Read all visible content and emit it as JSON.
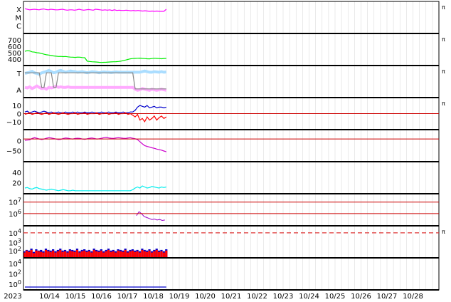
{
  "chart_data": {
    "type": "line",
    "start_label": "2023",
    "x_tick_labels": [
      "10/14",
      "10/15",
      "10/16",
      "10/17",
      "10/18",
      "10/19",
      "10/20",
      "10/21",
      "10/22",
      "10/23",
      "10/24",
      "10/25",
      "10/26",
      "10/27",
      "10/28"
    ],
    "x_range": [
      "2023-10-13",
      "2023-10-29"
    ],
    "data_end": "2023-10-18.5",
    "grid": true,
    "right_marker": "π",
    "panels": [
      {
        "id": "xray",
        "ytick_labels": [
          "X",
          "M",
          "C"
        ],
        "right_marker": true,
        "series": [
          {
            "color": "#ff00ff",
            "values": [
              0.8,
              0.78,
              0.76,
              0.77,
              0.78,
              0.77,
              0.76,
              0.78,
              0.79,
              0.77,
              0.76,
              0.78,
              0.77,
              0.76,
              0.76,
              0.77,
              0.78,
              0.76,
              0.75,
              0.76,
              0.76,
              0.75,
              0.76,
              0.78,
              0.76,
              0.75,
              0.76,
              0.77,
              0.76,
              0.75,
              0.78,
              0.77,
              0.76,
              0.75,
              0.76,
              0.75,
              0.76,
              0.74,
              0.76,
              0.74,
              0.75,
              0.74,
              0.74,
              0.75,
              0.74,
              0.73,
              0.74,
              0.73,
              0.74,
              0.73,
              0.72,
              0.73,
              0.72,
              0.71,
              0.72,
              0.71,
              0.72,
              0.71,
              0.71,
              0.71,
              0.78
            ]
          }
        ]
      },
      {
        "id": "wind_speed",
        "ytick_labels": [
          "700",
          "600",
          "500",
          "400"
        ],
        "yrange": [
          300,
          800
        ],
        "right_marker": true,
        "series": [
          {
            "color": "#00ee00",
            "values": [
              520,
              530,
              525,
              510,
              505,
              495,
              490,
              480,
              470,
              460,
              455,
              448,
              440,
              435,
              430,
              432,
              428,
              430,
              425,
              420,
              418,
              415,
              420,
              418,
              412,
              410,
              350,
              345,
              340,
              338,
              335,
              330,
              328,
              330,
              332,
              335,
              338,
              340,
              342,
              345,
              350,
              360,
              370,
              380,
              390,
              395,
              398,
              400,
              402,
              398,
              395,
              392,
              390,
              395,
              400,
              398,
              395,
              392,
              396,
              398
            ]
          }
        ]
      },
      {
        "id": "mag_sector",
        "ytick_labels": [
          "T",
          "A"
        ],
        "right_marker": true,
        "series": [
          {
            "color": "#aaddff",
            "values": [
              0.78,
              0.8,
              0.82,
              0.85,
              0.8,
              0.78,
              0.75,
              0.8,
              0.82,
              0.85,
              0.88,
              0.84,
              0.8,
              0.82,
              0.86,
              0.88,
              0.85,
              0.82,
              0.84,
              0.86,
              0.85,
              0.84,
              0.82,
              0.83,
              0.84,
              0.82,
              0.8,
              0.82,
              0.84,
              0.83,
              0.82,
              0.8,
              0.82,
              0.83,
              0.82,
              0.82,
              0.81,
              0.82,
              0.83,
              0.82,
              0.82,
              0.82,
              0.82,
              0.82,
              0.82,
              0.82,
              0.82,
              0.82,
              0.82,
              0.84,
              0.86,
              0.84,
              0.82,
              0.82,
              0.84,
              0.83,
              0.82,
              0.84,
              0.82,
              0.83
            ]
          },
          {
            "color": "#ffaaff",
            "values": [
              0.3,
              0.28,
              0.32,
              0.26,
              0.3,
              0.35,
              0.3,
              0.26,
              0.28,
              0.24,
              0.3,
              0.28,
              0.3,
              0.34,
              0.3,
              0.32,
              0.3,
              0.3,
              0.32,
              0.3,
              0.3,
              0.3,
              0.3,
              0.3,
              0.3,
              0.3,
              0.3,
              0.3,
              0.3,
              0.3,
              0.3,
              0.3,
              0.3,
              0.3,
              0.3,
              0.3,
              0.3,
              0.3,
              0.3,
              0.3,
              0.3,
              0.3,
              0.3,
              0.3,
              0.3,
              0.3,
              0.24,
              0.2,
              0.22,
              0.26,
              0.24,
              0.22,
              0.2,
              0.24,
              0.22,
              0.2,
              0.22,
              0.24,
              0.22,
              0.2
            ]
          },
          {
            "color": "#888888",
            "values": [
              0.8,
              0.8,
              0.8,
              0.8,
              0.8,
              0.8,
              0.8,
              0.3,
              0.3,
              0.8,
              0.8,
              0.8,
              0.3,
              0.3,
              0.8,
              0.8,
              0.8,
              0.8,
              0.8,
              0.8,
              0.8,
              0.8,
              0.8,
              0.8,
              0.8,
              0.8,
              0.8,
              0.8,
              0.8,
              0.8,
              0.8,
              0.8,
              0.8,
              0.8,
              0.8,
              0.8,
              0.8,
              0.8,
              0.8,
              0.8,
              0.8,
              0.8,
              0.8,
              0.8,
              0.8,
              0.8,
              0.25,
              0.25,
              0.25,
              0.25,
              0.25,
              0.25,
              0.25,
              0.25,
              0.25,
              0.25,
              0.25,
              0.25,
              0.25,
              0.25
            ]
          }
        ]
      },
      {
        "id": "imf_bz",
        "ytick_labels": [
          "10",
          "0",
          "−10"
        ],
        "yrange": [
          -18,
          18
        ],
        "zero_line": true,
        "right_marker": true,
        "series": [
          {
            "color": "#0000cc",
            "values": [
              2,
              3,
              1,
              2,
              3,
              2,
              1,
              2,
              3,
              2,
              1,
              2,
              1,
              1,
              2,
              1,
              1,
              2,
              1,
              1,
              2,
              1,
              2,
              1,
              1,
              2,
              1,
              1,
              2,
              1,
              1,
              1,
              2,
              1,
              1,
              2,
              1,
              1,
              2,
              1,
              1,
              2,
              1,
              1,
              2,
              2,
              4,
              8,
              10,
              9,
              8,
              10,
              7,
              8,
              9,
              7,
              8,
              8,
              7,
              8
            ]
          },
          {
            "color": "#ff0000",
            "values": [
              -1,
              0,
              1,
              -1,
              0,
              1,
              0,
              -1,
              0,
              1,
              -1,
              0,
              1,
              0,
              -1,
              0,
              1,
              0,
              -1,
              0,
              0,
              1,
              -1,
              0,
              0,
              1,
              -1,
              0,
              0,
              0,
              1,
              -1,
              0,
              0,
              1,
              -1,
              0,
              0,
              1,
              -1,
              0,
              0,
              1,
              -1,
              0,
              -2,
              -4,
              -1,
              -8,
              -6,
              -10,
              -4,
              -8,
              -6,
              -3,
              -8,
              -5,
              -3,
              -6,
              -4
            ]
          }
        ]
      },
      {
        "id": "dst",
        "ytick_labels": [
          "0",
          "−50"
        ],
        "yrange": [
          -80,
          30
        ],
        "zero_line": true,
        "series": [
          {
            "color": "#cc00cc",
            "values": [
              -5,
              -4,
              -3,
              2,
              5,
              3,
              0,
              -2,
              0,
              3,
              5,
              4,
              2,
              0,
              -2,
              -1,
              2,
              4,
              3,
              1,
              0,
              2,
              3,
              2,
              0,
              -1,
              1,
              3,
              4,
              2,
              0,
              1,
              3,
              5,
              6,
              4,
              3,
              2,
              4,
              5,
              4,
              3,
              2,
              4,
              5,
              3,
              1,
              -2,
              -10,
              -18,
              -25,
              -28,
              -30,
              -33,
              -35,
              -38,
              -40,
              -42,
              -45,
              -48
            ]
          }
        ]
      },
      {
        "id": "density",
        "ytick_labels": [
          "40",
          "20"
        ],
        "yrange": [
          0,
          55
        ],
        "series": [
          {
            "color": "#00eeee",
            "values": [
              8,
              9,
              7,
              6,
              8,
              9,
              7,
              6,
              5,
              4,
              5,
              6,
              5,
              4,
              3,
              4,
              5,
              4,
              3,
              3,
              4,
              3,
              3,
              3,
              3,
              3,
              3,
              3,
              3,
              3,
              3,
              3,
              3,
              3,
              3,
              3,
              3,
              3,
              3,
              3,
              3,
              3,
              3,
              3,
              3,
              5,
              8,
              10,
              8,
              12,
              10,
              8,
              9,
              11,
              10,
              9,
              8,
              10,
              9,
              10
            ]
          }
        ]
      },
      {
        "id": "proton_flux",
        "ytick_labels": [
          "10^7",
          "10^6"
        ],
        "red_lines": [
          7,
          6
        ],
        "series": [
          {
            "color": "#9900cc",
            "values": [
              5.4,
              5.8,
              5.6,
              5.3,
              5.2,
              5.1,
              5.0,
              5.05,
              4.95,
              5.0,
              4.9,
              4.95
            ]
          }
        ]
      },
      {
        "id": "electron_flux",
        "ytick_labels": [
          "10^4",
          "10^3",
          "10^2"
        ],
        "dashed_line": 4,
        "right_marker": true,
        "series": [
          {
            "color": "#0000cc",
            "values": [
              1.8,
              2.0,
              1.9,
              2.2,
              1.7,
              2.1,
              1.9,
              2.0,
              1.8,
              2.2,
              2.0,
              1.9,
              2.1,
              1.8,
              2.0,
              2.2,
              1.9,
              2.0,
              1.8,
              2.1,
              2.0,
              1.9,
              2.2,
              1.8,
              2.0,
              2.1,
              1.9,
              2.0,
              1.8,
              2.2,
              2.0,
              1.9,
              2.1,
              1.8,
              2.0,
              2.2,
              1.9,
              2.0,
              1.8,
              2.1,
              2.0,
              1.9,
              2.2,
              1.8,
              2.0,
              2.1,
              1.9,
              2.0,
              1.8,
              2.2,
              2.0,
              1.9,
              2.1,
              1.8,
              2.0,
              2.2,
              1.9,
              2.0,
              1.8,
              2.1
            ]
          },
          {
            "color": "#ff0000",
            "values": [
              1.6,
              1.9,
              1.7,
              2.0,
              1.5,
              1.9,
              1.8,
              1.7,
              1.6,
              2.0,
              1.8,
              1.7,
              1.9,
              1.6,
              1.8,
              2.0,
              1.7,
              1.8,
              1.6,
              1.9,
              1.8,
              1.7,
              2.0,
              1.6,
              1.8,
              1.9,
              1.7,
              1.8,
              1.6,
              2.0,
              1.8,
              1.7,
              1.9,
              1.6,
              1.8,
              2.0,
              1.7,
              1.8,
              1.6,
              1.9,
              1.8,
              1.7,
              2.0,
              1.6,
              1.8,
              1.9,
              1.7,
              1.8,
              1.6,
              2.0,
              1.8,
              1.7,
              1.9,
              1.6,
              1.8,
              2.0,
              1.7,
              1.8,
              1.6,
              1.9
            ]
          }
        ]
      },
      {
        "id": "neutron",
        "ytick_labels": [
          "10^4",
          "10^2",
          "10^0"
        ],
        "series": [
          {
            "color": "#0000cc",
            "values": [
              0.0,
              0.0,
              0.0,
              0.0,
              0.0,
              0.0,
              0.0,
              0.0,
              0.0,
              0.0,
              0.0,
              0.0,
              0.0,
              0.0,
              0.0,
              0.0,
              0.0,
              0.0,
              0.0,
              0.0
            ]
          }
        ]
      }
    ]
  }
}
